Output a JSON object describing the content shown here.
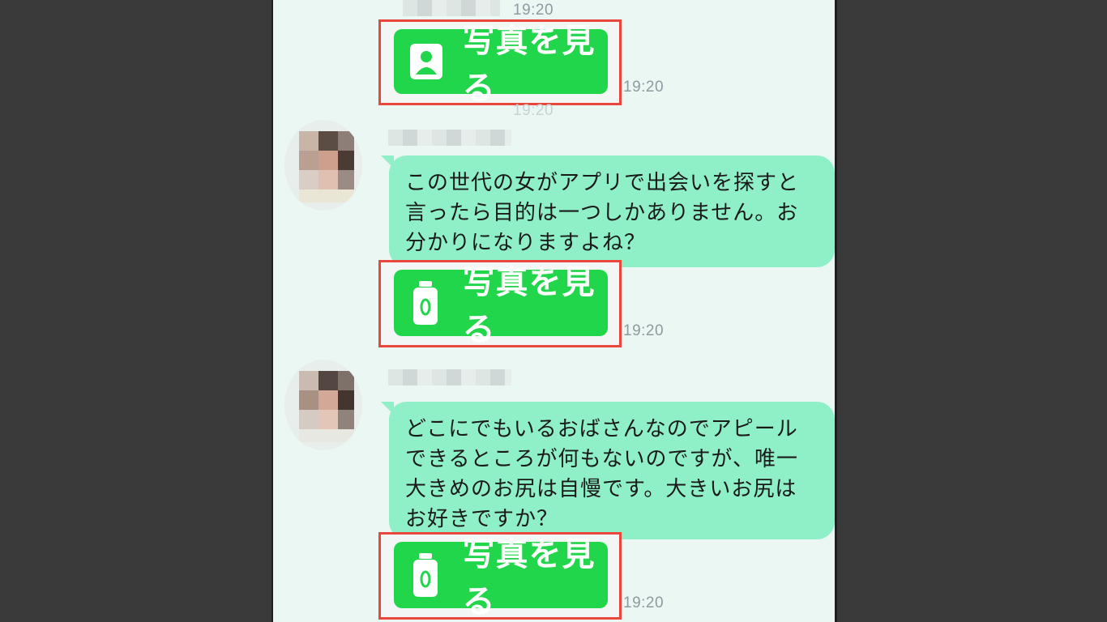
{
  "colors": {
    "background": "#3a3a3a",
    "screen": "#eaf7f3",
    "bubble": "#8ff0c8",
    "photo_button": "#21d64a",
    "highlight_box": "#e9473c",
    "timestamp": "#8f9aa0"
  },
  "messages": [
    {
      "time_top": "19:20",
      "photo_button": {
        "label": "写真を見る",
        "icon": "person-card-icon"
      },
      "time": "19:20",
      "time_ghost": "19:20"
    },
    {
      "text_lines": [
        "この世代の女がアプリで出会いを探すと",
        "言ったら目的は一つしかありません。お",
        "分かりになりますよね？"
      ],
      "photo_button": {
        "label": "写真を見る",
        "icon": "bottle-icon"
      },
      "time": "19:20"
    },
    {
      "text_lines": [
        "どこにでもいるおばさんなのでアピール",
        "できるところが何もないのですが、唯一",
        "大きめのお尻は自慢です。大きいお尻は",
        "お好きですか？"
      ],
      "photo_button": {
        "label": "写真を見る",
        "icon": "bottle-icon"
      },
      "time": "19:20"
    }
  ]
}
